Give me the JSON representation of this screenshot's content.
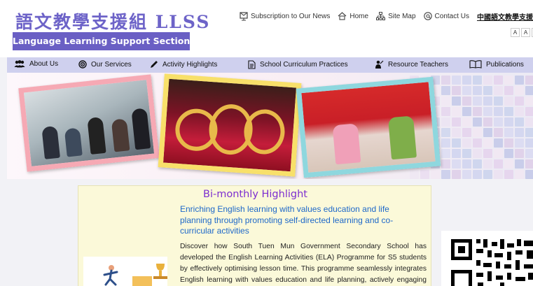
{
  "header": {
    "logo_chinese": "語文教學支援組 LLSS",
    "logo_english": "Language Learning Support Section",
    "top_links": [
      {
        "label": "Subscription to Our News",
        "icon": "subscription-icon"
      },
      {
        "label": "Home",
        "icon": "home-icon"
      },
      {
        "label": "Site Map",
        "icon": "sitemap-icon"
      },
      {
        "label": "Contact Us",
        "icon": "contact-icon"
      }
    ],
    "chinese_link": "中國語文教學支援服務",
    "font_size_buttons": [
      "A",
      "A",
      "A"
    ]
  },
  "nav": {
    "items": [
      {
        "label": "About Us",
        "icon": "people-icon"
      },
      {
        "label": "Our Services",
        "icon": "target-icon"
      },
      {
        "label": "Activity Highlights",
        "icon": "pen-icon"
      },
      {
        "label": "School Curriculum Practices",
        "icon": "document-icon"
      },
      {
        "label": "Resource Teachers",
        "icon": "teacher-icon"
      },
      {
        "label": "Publications",
        "icon": "book-icon"
      }
    ]
  },
  "highlight": {
    "title": "Bi-monthly Highlight",
    "subtitle": "Enriching English learning with values education and life planning through promoting self-directed learning and co-curricular activities",
    "body": "Discover how South Tuen Mun Government Secondary School has developed the English Learning Activities (ELA) Programme for S5 students by effectively optimising lesson time. This programme seamlessly integrates English learning with values education and life planning, actively engaging students in"
  },
  "colors": {
    "brand_purple": "#6a5fc4",
    "nav_bg": "#cfd0ee",
    "highlight_title": "#7d2fd0",
    "highlight_subtitle": "#1e68c9",
    "card_bg": "#fbf9d9"
  }
}
